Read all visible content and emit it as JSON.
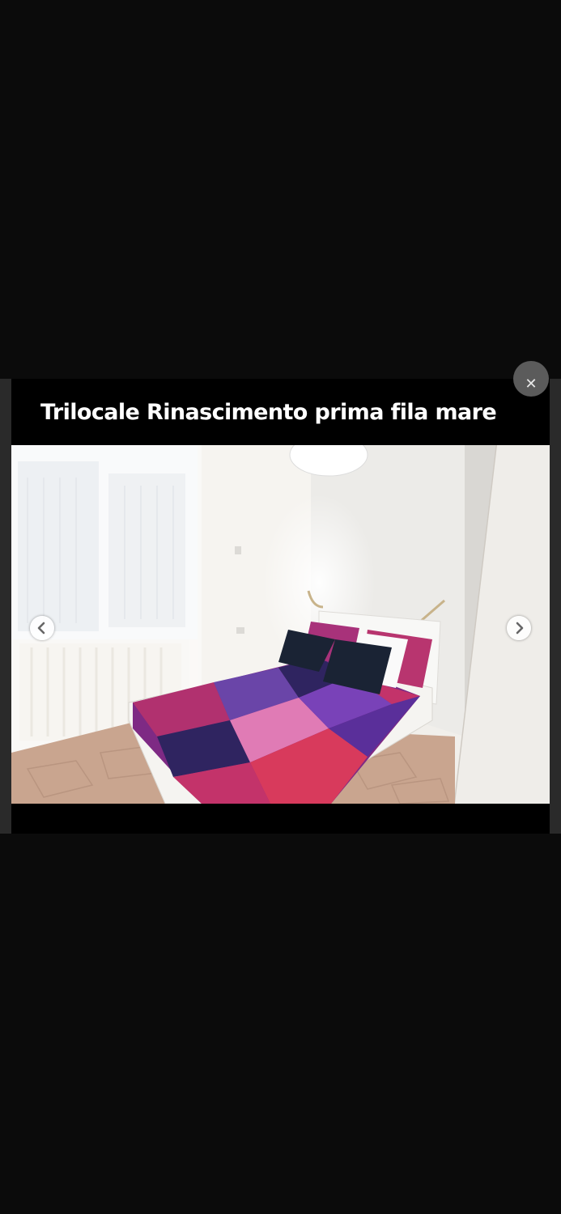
{
  "listing": {
    "title": "Trilocale Rinascimento prima fila mare"
  },
  "controls": {
    "close_icon": "close-icon",
    "prev_icon": "chevron-left-icon",
    "next_icon": "chevron-right-icon"
  },
  "photo": {
    "subject": "bedroom-photo"
  }
}
